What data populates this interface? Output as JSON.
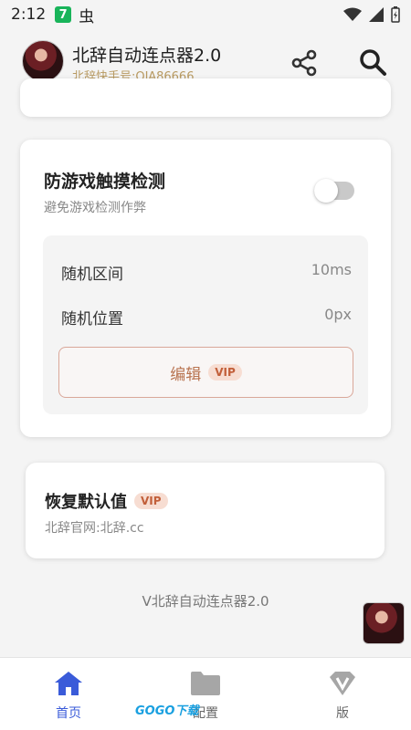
{
  "status_bar": {
    "time": "2:12",
    "app_icon_label": "7",
    "bug_glyph": "虫"
  },
  "header": {
    "title": "北辞自动连点器2.0",
    "subtitle": "北辞快手号:QJA86666",
    "icons": [
      "share-icon",
      "search-icon"
    ]
  },
  "anti_detect": {
    "title": "防游戏触摸检测",
    "description": "避免游戏检测作弊",
    "toggle_on": false,
    "params": [
      {
        "label": "随机区间",
        "value": "10ms"
      },
      {
        "label": "随机位置",
        "value": "0px"
      }
    ],
    "edit_label": "编辑",
    "vip_label": "VIP"
  },
  "restore": {
    "title": "恢复默认值",
    "vip_label": "VIP",
    "description": "北辞官网:北辞.cc"
  },
  "footer_text": "V北辞自动连点器2.0",
  "bottom_nav": [
    {
      "label": "首页",
      "icon": "home-icon",
      "active": true
    },
    {
      "label": "配置",
      "icon": "folder-icon",
      "active": false
    },
    {
      "label": "版",
      "icon": "vip-diamond-icon",
      "active": false
    }
  ],
  "watermark": "GOGO下载",
  "colors": {
    "accent": "#3a5bd9",
    "vip": "#c25f3a",
    "subtitle_gold": "#b89a62"
  }
}
